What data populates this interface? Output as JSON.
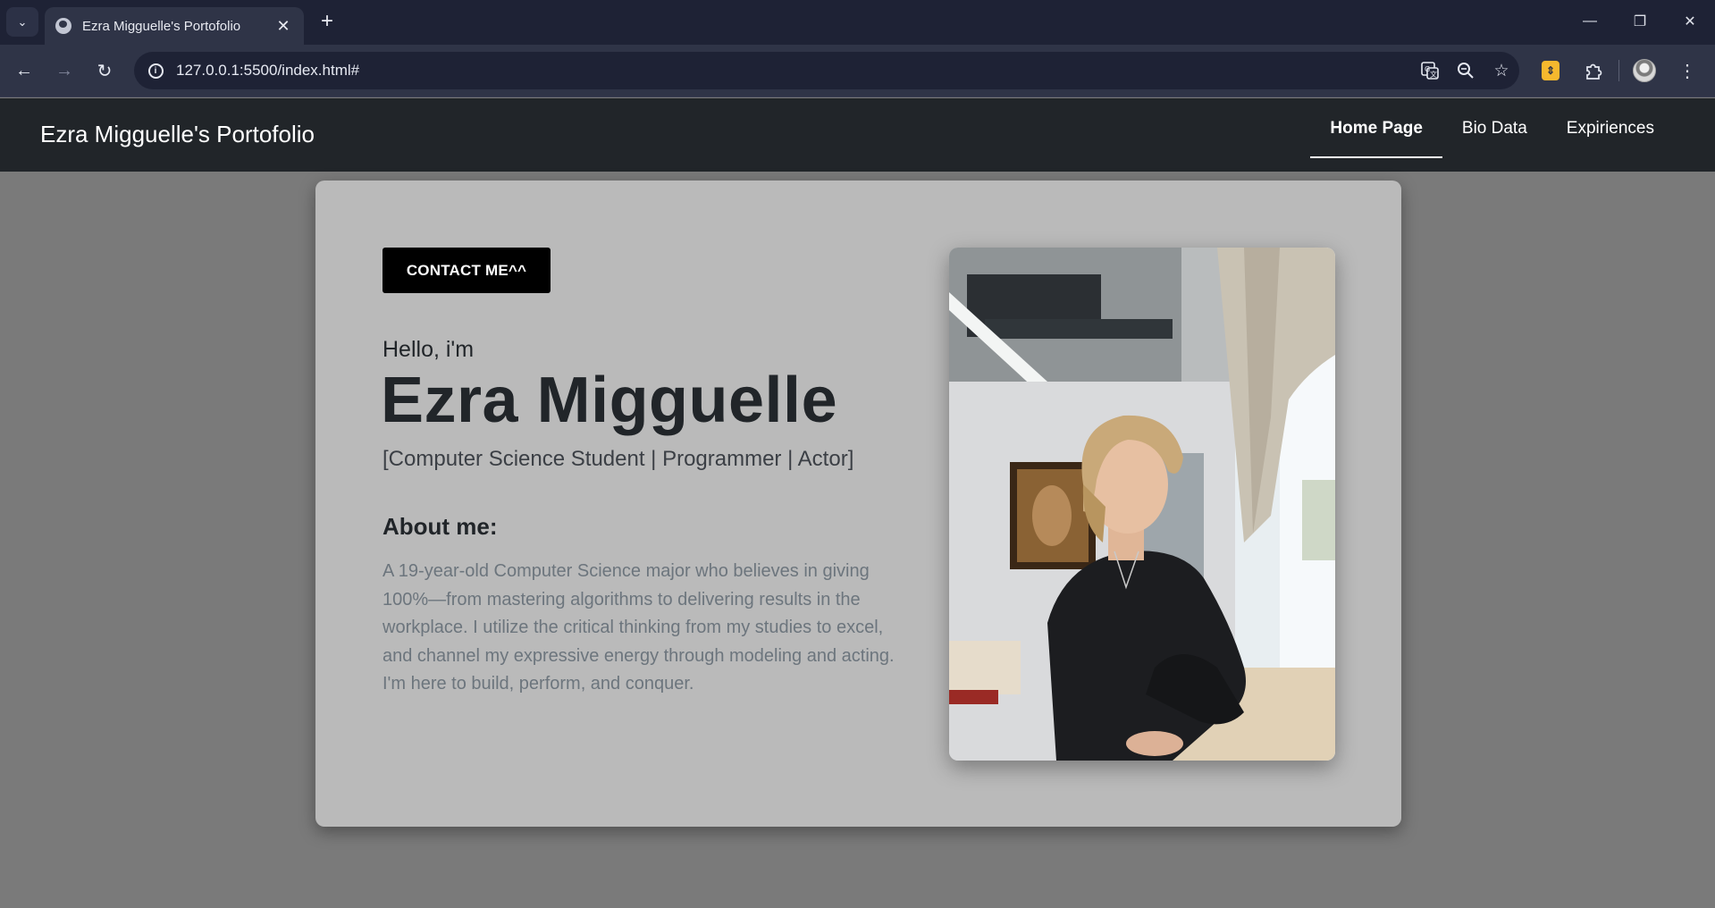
{
  "browser": {
    "tab_title": "Ezra Migguelle's Portofolio",
    "url": "127.0.0.1:5500/index.html#"
  },
  "site": {
    "brand": "Ezra Migguelle's Portofolio",
    "nav": [
      {
        "label": "Home Page",
        "active": true
      },
      {
        "label": "Bio Data",
        "active": false
      },
      {
        "label": "Expiriences",
        "active": false
      }
    ]
  },
  "hero": {
    "contact_button": "CONTACT ME^^",
    "greeting": "Hello, i'm",
    "name": "Ezra Migguelle",
    "roles": "[Computer Science Student | Programmer | Actor]",
    "about_heading": "About me:",
    "about_text": "A 19-year-old Computer Science major who believes in giving 100%—from mastering algorithms to delivering results in the workplace. I utilize the critical thinking from my studies to excel, and channel my expressive energy through modeling and acting. I'm here to build, perform, and conquer."
  },
  "colors": {
    "navbar_bg": "#212529",
    "page_bg": "#7a7a7a",
    "card_bg": "#bababa",
    "button_bg": "#000000",
    "body_text": "#6c757d"
  }
}
